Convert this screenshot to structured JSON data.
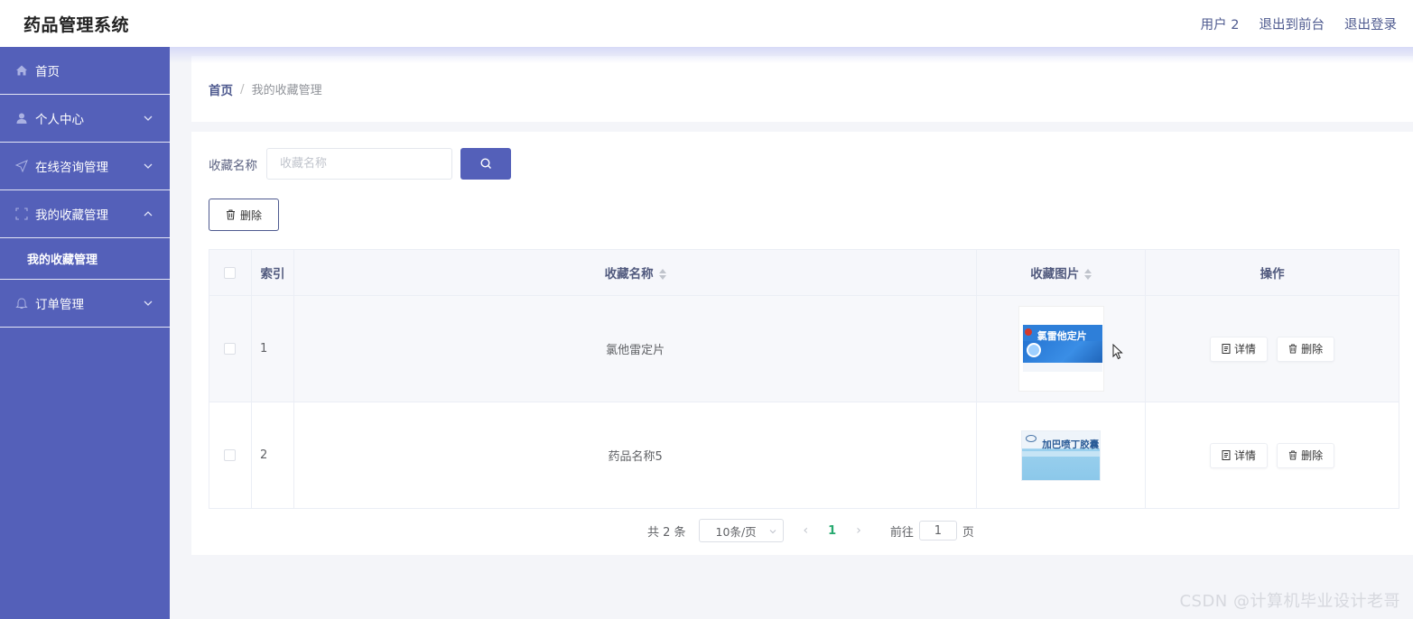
{
  "header": {
    "title": "药品管理系统",
    "user": "用户 2",
    "exit_front": "退出到前台",
    "logout": "退出登录"
  },
  "sidebar": {
    "items": [
      {
        "label": "首页",
        "icon": "home-icon"
      },
      {
        "label": "个人中心",
        "icon": "user-icon"
      },
      {
        "label": "在线咨询管理",
        "icon": "send-icon"
      },
      {
        "label": "我的收藏管理",
        "icon": "frame-icon",
        "submenu": "我的收藏管理"
      },
      {
        "label": "订单管理",
        "icon": "bell-icon"
      }
    ],
    "bg_color": "#5460b9"
  },
  "breadcrumb": {
    "home": "首页",
    "sep": "/",
    "current": "我的收藏管理"
  },
  "search": {
    "label": "收藏名称",
    "placeholder": "收藏名称"
  },
  "toolbar": {
    "delete_label": "删除"
  },
  "table": {
    "headers": {
      "index": "索引",
      "name": "收藏名称",
      "image": "收藏图片",
      "ops": "操作"
    },
    "rows": [
      {
        "index": "1",
        "name": "氯他雷定片",
        "image_text": "氯雷他定片"
      },
      {
        "index": "2",
        "name": "药品名称5",
        "image_text": "加巴喷丁胶囊"
      }
    ],
    "detail_label": "详情",
    "delete_label": "删除"
  },
  "pagination": {
    "total": "共 2 条",
    "page_size": "10条/页",
    "current": "1",
    "goto_label": "前往",
    "goto_value": "1",
    "page_unit": "页"
  },
  "watermark": "CSDN @计算机毕业设计老哥"
}
